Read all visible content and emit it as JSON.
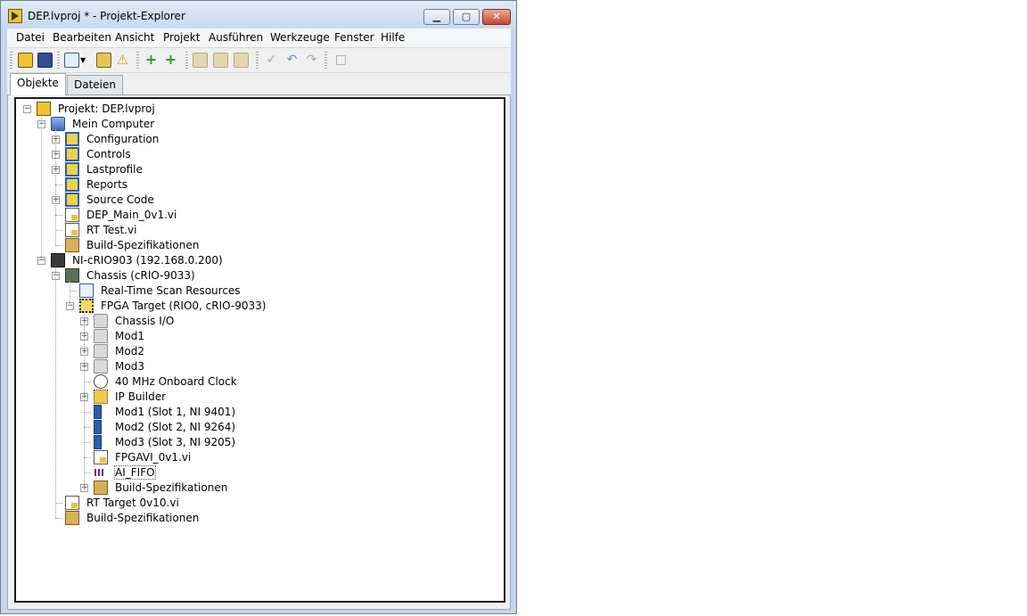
{
  "window": {
    "title": "DEP.lvproj * - Projekt-Explorer"
  },
  "menu": [
    "Datei",
    "Bearbeiten",
    "Ansicht",
    "Projekt",
    "Ausführen",
    "Werkzeuge",
    "Fenster",
    "Hilfe"
  ],
  "tabs": [
    "Objekte",
    "Dateien"
  ],
  "tree": [
    {
      "label": "Projekt: DEP.lvproj",
      "level": 0,
      "expander": "minus",
      "icon": "project-icon"
    },
    {
      "label": "Mein Computer",
      "level": 1,
      "expander": "minus",
      "icon": "computer-icon"
    },
    {
      "label": "Configuration",
      "level": 2,
      "expander": "plus",
      "icon": "virtual-folder-icon"
    },
    {
      "label": "Controls",
      "level": 2,
      "expander": "plus",
      "icon": "virtual-folder-icon"
    },
    {
      "label": "Lastprofile",
      "level": 2,
      "expander": "plus",
      "icon": "virtual-folder-icon"
    },
    {
      "label": "Reports",
      "level": 2,
      "expander": "none",
      "icon": "virtual-folder-icon"
    },
    {
      "label": "Source Code",
      "level": 2,
      "expander": "plus",
      "icon": "virtual-folder-icon"
    },
    {
      "label": "DEP_Main_0v1.vi",
      "level": 2,
      "expander": "none",
      "icon": "vi-icon"
    },
    {
      "label": "RT Test.vi",
      "level": 2,
      "expander": "none",
      "icon": "vi-icon"
    },
    {
      "label": "Build-Spezifikationen",
      "level": 2,
      "expander": "none",
      "icon": "build-spec-icon"
    },
    {
      "label": "NI-cRIO903 (192.168.0.200)",
      "level": 1,
      "expander": "minus",
      "icon": "crio-target-icon"
    },
    {
      "label": "Chassis (cRIO-9033)",
      "level": 2,
      "expander": "minus",
      "icon": "chassis-icon"
    },
    {
      "label": "Real-Time Scan Resources",
      "level": 3,
      "expander": "none",
      "icon": "scan-resources-icon"
    },
    {
      "label": "FPGA Target (RIO0, cRIO-9033)",
      "level": 3,
      "expander": "minus",
      "icon": "fpga-target-icon"
    },
    {
      "label": "Chassis I/O",
      "level": 4,
      "expander": "plus",
      "icon": "folder-icon"
    },
    {
      "label": "Mod1",
      "level": 4,
      "expander": "plus",
      "icon": "folder-icon"
    },
    {
      "label": "Mod2",
      "level": 4,
      "expander": "plus",
      "icon": "folder-icon"
    },
    {
      "label": "Mod3",
      "level": 4,
      "expander": "plus",
      "icon": "folder-icon"
    },
    {
      "label": "40 MHz Onboard Clock",
      "level": 4,
      "expander": "none",
      "icon": "clock-icon"
    },
    {
      "label": "IP Builder",
      "level": 4,
      "expander": "plus",
      "icon": "ip-builder-icon"
    },
    {
      "label": "Mod1 (Slot 1, NI 9401)",
      "level": 4,
      "expander": "none",
      "icon": "module-icon"
    },
    {
      "label": "Mod2 (Slot 2, NI 9264)",
      "level": 4,
      "expander": "none",
      "icon": "module-icon"
    },
    {
      "label": "Mod3 (Slot 3, NI 9205)",
      "level": 4,
      "expander": "none",
      "icon": "module-icon"
    },
    {
      "label": "FPGAVI_0v1.vi",
      "level": 4,
      "expander": "none",
      "icon": "vi-icon"
    },
    {
      "label": "AI_FIFO",
      "level": 4,
      "expander": "none",
      "icon": "fifo-icon"
    },
    {
      "label": "Build-Spezifikationen",
      "level": 4,
      "expander": "plus",
      "icon": "build-spec-icon"
    },
    {
      "label": "RT Target 0v10.vi",
      "level": 2,
      "expander": "none",
      "icon": "vi-icon"
    },
    {
      "label": "Build-Spezifikationen",
      "level": 2,
      "expander": "none",
      "icon": "build-spec-icon"
    }
  ]
}
